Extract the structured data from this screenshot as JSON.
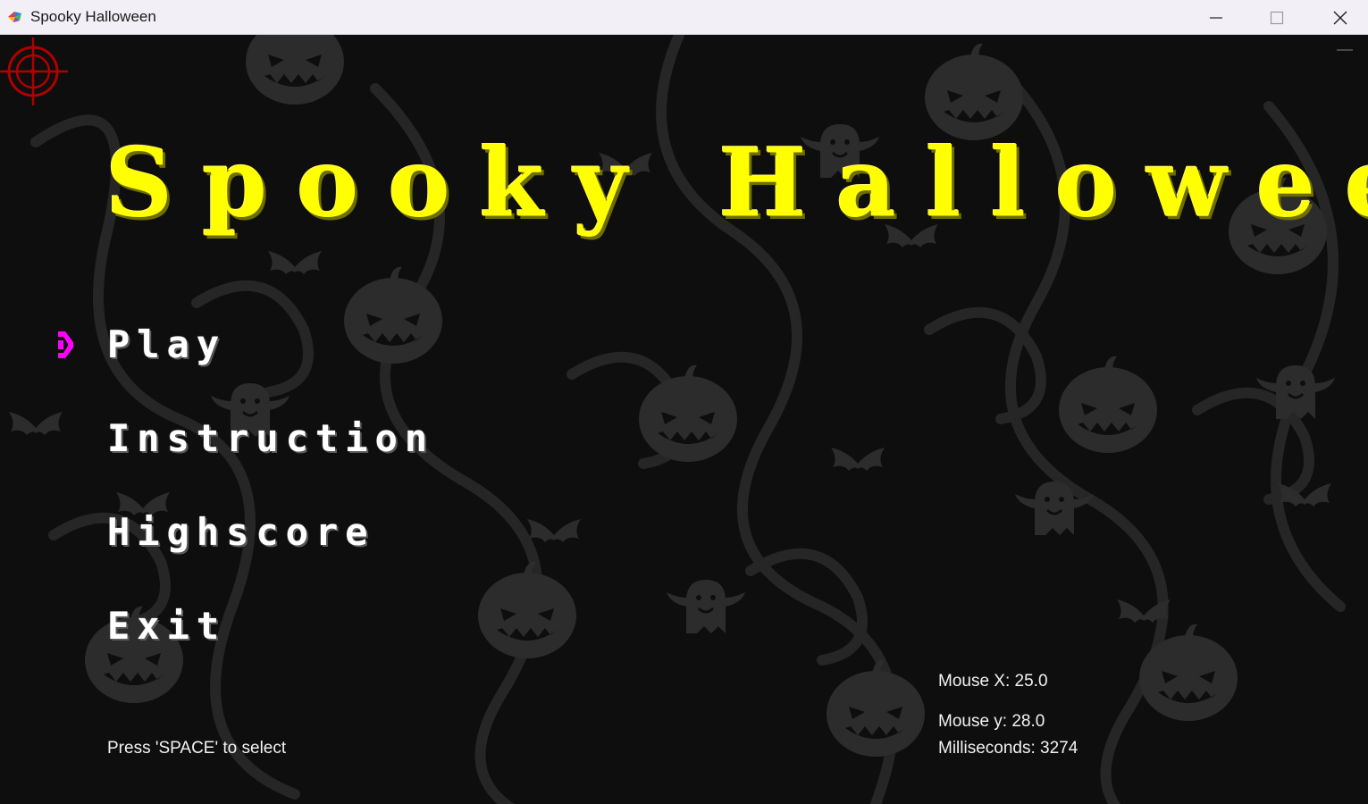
{
  "window": {
    "title": "Spooky Halloween",
    "app_icon": "colorful-bird-app-icon",
    "controls": {
      "minimize_icon": "minimize-icon",
      "maximize_icon": "maximize-icon",
      "close_icon": "close-icon"
    }
  },
  "game": {
    "title": "Spooky Halloween",
    "title_color": "#ffff00",
    "background_motif": "pumpkins-bats-ghosts-swirls",
    "cursor_icon": "red-crosshair-icon",
    "menu": {
      "items": [
        {
          "label": "Play",
          "selected": true
        },
        {
          "label": "Instruction",
          "selected": false
        },
        {
          "label": "Highscore",
          "selected": false
        },
        {
          "label": "Exit",
          "selected": false
        }
      ],
      "selector_icon": "magenta-arrow-icon",
      "selector_color": "#ff00ff"
    },
    "hint": "Press 'SPACE' to select",
    "debug": {
      "mouse_x": "Mouse X: 25.0",
      "mouse_y": "Mouse y: 28.0",
      "milliseconds": "Milliseconds: 3274"
    }
  }
}
